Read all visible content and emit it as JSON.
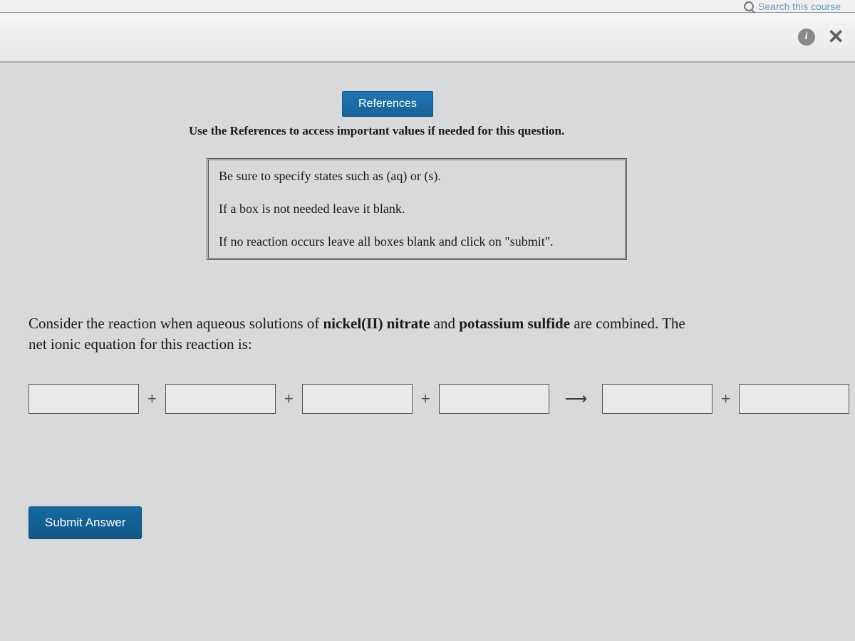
{
  "topbar": {
    "search_placeholder_fragment": "Search this course"
  },
  "toolbar": {
    "info": "i",
    "close": "✕"
  },
  "references": {
    "button_label": "References",
    "usage_hint": "Use the References to access important values if needed for this question."
  },
  "instructions": {
    "line1": "Be sure to specify states such as (aq) or (s).",
    "line2": "If a box is not needed leave it blank.",
    "line3": "If no reaction occurs leave all boxes blank and click on \"submit\"."
  },
  "question": {
    "prefix": "Consider the reaction when aqueous solutions of ",
    "bold1": "nickel(II) nitrate",
    "mid": " and ",
    "bold2": "potassium sulfide",
    "suffix": " are combined. The net ionic equation for this reaction is:"
  },
  "equation": {
    "plus": "+",
    "arrow": "⟶",
    "box1": "",
    "box2": "",
    "box3": "",
    "box4": "",
    "box5": "",
    "box6": ""
  },
  "submit_label": "Submit Answer"
}
